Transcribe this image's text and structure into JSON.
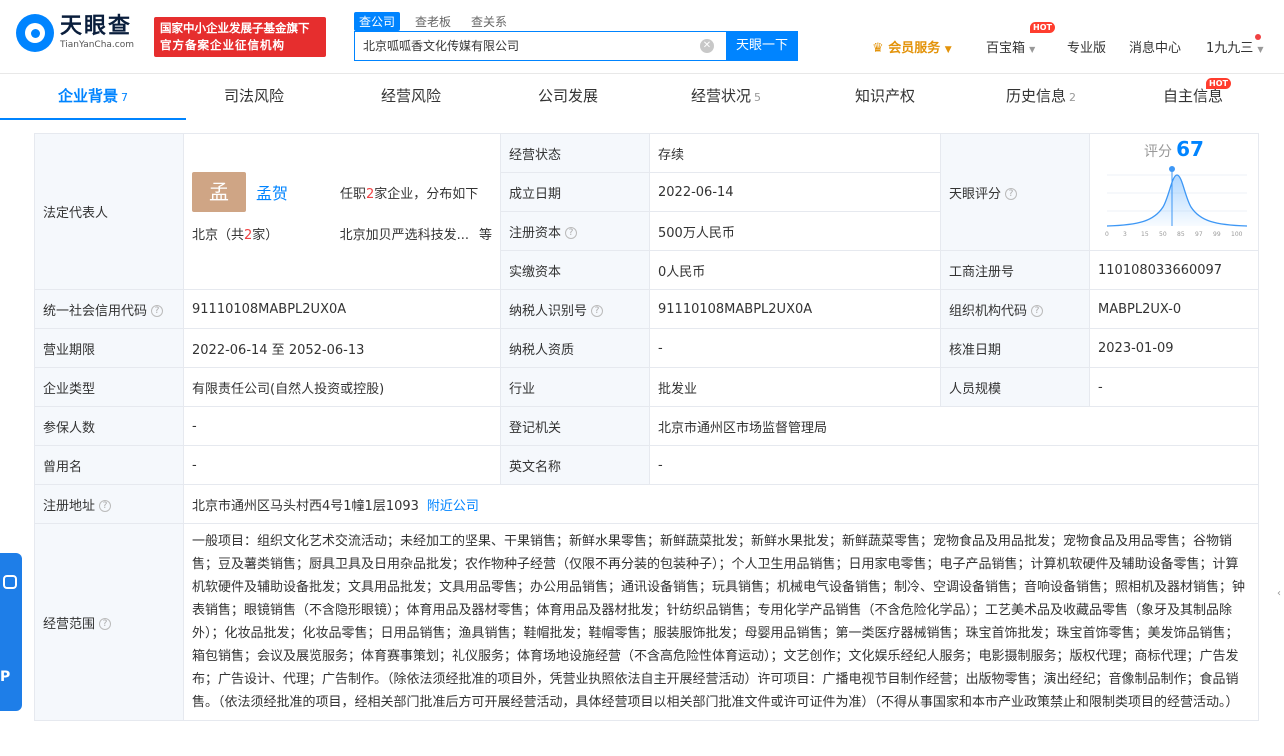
{
  "header": {
    "logo_cn": "天眼查",
    "logo_en": "TianYanCha.com",
    "badge_line1": "国家中小企业发展子基金旗下",
    "badge_line2": "官方备案企业征信机构",
    "search_tabs": [
      "查公司",
      "查老板",
      "查关系"
    ],
    "search_value": "北京呱呱香文化传媒有限公司",
    "search_button": "天眼一下",
    "nav": {
      "vip": "会员服务",
      "baibao": "百宝箱",
      "pro": "专业版",
      "msg": "消息中心",
      "user": "1九九三"
    },
    "hot": "HOT"
  },
  "tabs": [
    {
      "label": "企业背景",
      "count": "7"
    },
    {
      "label": "司法风险",
      "count": ""
    },
    {
      "label": "经营风险",
      "count": ""
    },
    {
      "label": "公司发展",
      "count": ""
    },
    {
      "label": "经营状况",
      "count": "5"
    },
    {
      "label": "知识产权",
      "count": ""
    },
    {
      "label": "历史信息",
      "count": "2"
    },
    {
      "label": "自主信息",
      "count": ""
    }
  ],
  "legal": {
    "label": "法定代表人",
    "avatar": "孟",
    "name": "孟贺",
    "desc_pre": "任职",
    "desc_num": "2",
    "desc_post": "家企业，分布如下",
    "region_pre": "北京（共",
    "region_num": "2",
    "region_post": "家）",
    "company": "北京加贝严选科技发...",
    "more": "等"
  },
  "score": {
    "label": "天眼评分",
    "title": "评分",
    "value": "67",
    "axis": [
      "0",
      "3",
      "15",
      "50",
      "85",
      "97",
      "99",
      "100"
    ]
  },
  "fields": {
    "status_l": "经营状态",
    "status_v": "存续",
    "founded_l": "成立日期",
    "founded_v": "2022-06-14",
    "capital_l": "注册资本",
    "capital_v": "500万人民币",
    "paid_l": "实缴资本",
    "paid_v": "0人民币",
    "regno_l": "工商注册号",
    "regno_v": "110108033660097",
    "credit_l": "统一社会信用代码",
    "credit_v": "91110108MABPL2UX0A",
    "taxid_l": "纳税人识别号",
    "taxid_v": "91110108MABPL2UX0A",
    "org_l": "组织机构代码",
    "org_v": "MABPL2UX-0",
    "term_l": "营业期限",
    "term_v": "2022-06-14 至 2052-06-13",
    "taxq_l": "纳税人资质",
    "taxq_v": "-",
    "approve_l": "核准日期",
    "approve_v": "2023-01-09",
    "type_l": "企业类型",
    "type_v": "有限责任公司(自然人投资或控股)",
    "industry_l": "行业",
    "industry_v": "批发业",
    "staff_l": "人员规模",
    "staff_v": "-",
    "insured_l": "参保人数",
    "insured_v": "-",
    "authority_l": "登记机关",
    "authority_v": "北京市通州区市场监督管理局",
    "former_l": "曾用名",
    "former_v": "-",
    "en_l": "英文名称",
    "en_v": "-",
    "addr_l": "注册地址",
    "addr_v": "北京市通州区马头村西4号1幢1层1093",
    "addr_link": "附近公司",
    "scope_l": "经营范围",
    "scope_v": "一般项目：组织文化艺术交流活动；未经加工的坚果、干果销售；新鲜水果零售；新鲜蔬菜批发；新鲜水果批发；新鲜蔬菜零售；宠物食品及用品批发；宠物食品及用品零售；谷物销售；豆及薯类销售；厨具卫具及日用杂品批发；农作物种子经营（仅限不再分装的包装种子）；个人卫生用品销售；日用家电零售；电子产品销售；计算机软硬件及辅助设备零售；计算机软硬件及辅助设备批发；文具用品批发；文具用品零售；办公用品销售；通讯设备销售；玩具销售；机械电气设备销售；制冷、空调设备销售；音响设备销售；照相机及器材销售；钟表销售；眼镜销售（不含隐形眼镜）；体育用品及器材零售；体育用品及器材批发；针纺织品销售；专用化学产品销售（不含危险化学品）；工艺美术品及收藏品零售（象牙及其制品除外）；化妆品批发；化妆品零售；日用品销售；渔具销售；鞋帽批发；鞋帽零售；服装服饰批发；母婴用品销售；第一类医疗器械销售；珠宝首饰批发；珠宝首饰零售；美发饰品销售；箱包销售；会议及展览服务；体育赛事策划；礼仪服务；体育场地设施经营（不含高危险性体育运动）；文艺创作；文化娱乐经纪人服务；电影摄制服务；版权代理；商标代理；广告发布；广告设计、代理；广告制作。（除依法须经批准的项目外，凭营业执照依法自主开展经营活动）许可项目：广播电视节目制作经营；出版物零售；演出经纪；音像制品制作；食品销售。（依法须经批准的项目，经相关部门批准后方可开展经营活动，具体经营项目以相关部门批准文件或许可证件为准）（不得从事国家和本市产业政策禁止和限制类项目的经营活动。）"
  },
  "colors": {
    "accent": "#0084ff",
    "badge": "#e62e2e",
    "vip": "#e3930a"
  }
}
